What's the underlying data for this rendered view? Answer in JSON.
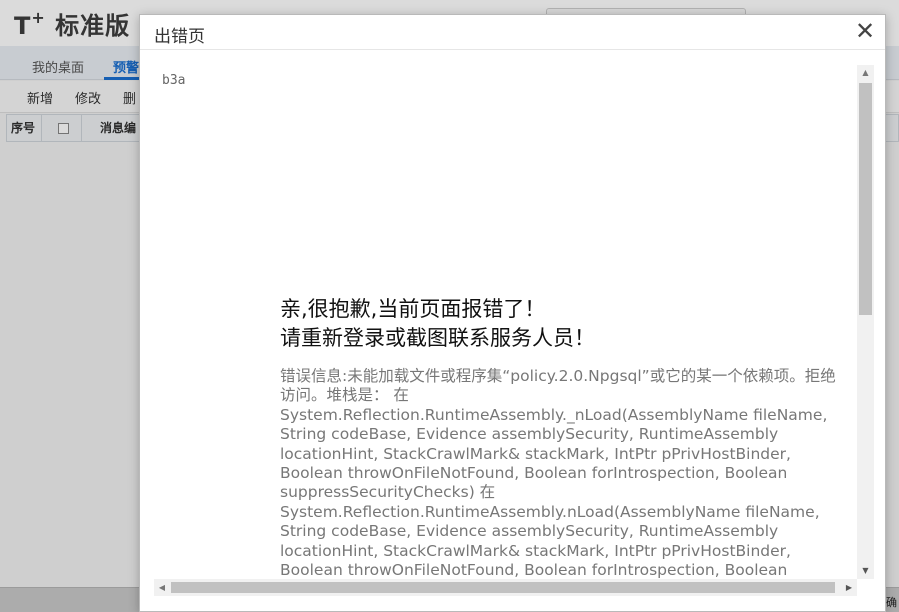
{
  "app": {
    "logo_text": "标准版",
    "logo_prefix": "T",
    "logo_plus": "+",
    "tabs": [
      {
        "label": "我的桌面"
      },
      {
        "label": "预警"
      }
    ],
    "toolbar": [
      {
        "label": "新增"
      },
      {
        "label": "修改"
      },
      {
        "label": "删"
      }
    ],
    "grid_columns": [
      {
        "label": "序号"
      },
      {
        "label": "消息编"
      }
    ],
    "status_text": "确"
  },
  "dialog": {
    "title": "出错页",
    "close_glyph": "✕",
    "error_code": "b3a",
    "headline_line1": "亲,很抱歉,当前页面报错了！",
    "headline_line2": "请重新登录或截图联系服务人员！",
    "error_detail": "错误信息:未能加载文件或程序集“policy.2.0.Npgsql”或它的某一个依赖项。拒绝访问。堆栈是： 在 System.Reflection.RuntimeAssembly._nLoad(AssemblyName fileName, String codeBase, Evidence assemblySecurity, RuntimeAssembly locationHint, StackCrawlMark& stackMark, IntPtr pPrivHostBinder, Boolean throwOnFileNotFound, Boolean forIntrospection, Boolean suppressSecurityChecks) 在 System.Reflection.RuntimeAssembly.nLoad(AssemblyName fileName, String codeBase, Evidence assemblySecurity, RuntimeAssembly locationHint, StackCrawlMark& stackMark, IntPtr pPrivHostBinder, Boolean throwOnFileNotFound, Boolean forIntrospection, Boolean suppressSecurityChecks) 在",
    "scroll": {
      "up_glyph": "▲",
      "down_glyph": "▼",
      "left_glyph": "◀",
      "right_glyph": "▶"
    }
  }
}
